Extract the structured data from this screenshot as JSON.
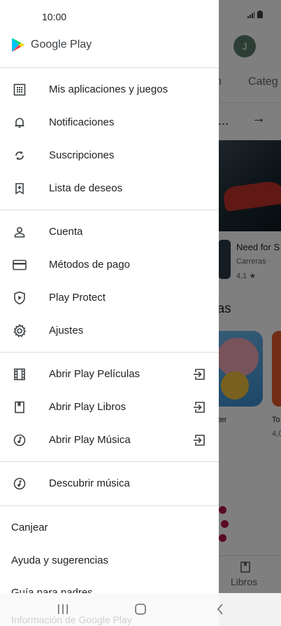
{
  "status_bar": {
    "time": "10:00",
    "signal_icon": "signal-icon",
    "battery_icon": "battery-icon"
  },
  "background_app": {
    "avatar_letter": "J",
    "tabs": [
      "n",
      "Categ"
    ],
    "section_more": "...",
    "game": {
      "title": "Need for S",
      "category": "Carreras  ·",
      "rating": "4,1 ★"
    },
    "heading": "das",
    "cards": [
      {
        "label": "aster"
      },
      {
        "label": "To",
        "sub": "4,0"
      }
    ],
    "bottom_nav": {
      "books_label": "Libros"
    }
  },
  "drawer": {
    "brand": "Google Play",
    "group1": [
      {
        "label": "Mis aplicaciones y juegos",
        "icon": "apps-grid-icon"
      },
      {
        "label": "Notificaciones",
        "icon": "bell-icon"
      },
      {
        "label": "Suscripciones",
        "icon": "refresh-icon"
      },
      {
        "label": "Lista de deseos",
        "icon": "bookmark-plus-icon"
      }
    ],
    "group2": [
      {
        "label": "Cuenta",
        "icon": "person-icon"
      },
      {
        "label": "Métodos de pago",
        "icon": "credit-card-icon"
      },
      {
        "label": "Play Protect",
        "icon": "shield-play-icon"
      },
      {
        "label": "Ajustes",
        "icon": "gear-icon"
      }
    ],
    "group3": [
      {
        "label": "Abrir Play Películas",
        "icon": "film-icon"
      },
      {
        "label": "Abrir Play Libros",
        "icon": "book-icon"
      },
      {
        "label": "Abrir Play Música",
        "icon": "music-icon"
      }
    ],
    "group4": [
      {
        "label": "Descubrir música",
        "icon": "music-icon"
      }
    ],
    "links": [
      "Canjear",
      "Ayuda y sugerencias",
      "Guía para padres",
      "Información de Google Play"
    ]
  },
  "system_nav": {
    "recents_icon": "recents-icon",
    "home_icon": "home-icon",
    "back_icon": "back-icon"
  }
}
